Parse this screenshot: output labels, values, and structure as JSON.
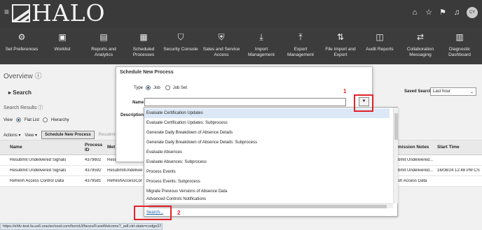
{
  "brand": {
    "logo_text": "HALO"
  },
  "topbar": {
    "avatar_initials": "CY"
  },
  "nav": [
    {
      "label": "Set Preferences",
      "icon": "person-gear-icon"
    },
    {
      "label": "Worklist",
      "icon": "clipboard-icon"
    },
    {
      "label": "Reports and Analytics",
      "icon": "chart-icon"
    },
    {
      "label": "Scheduled Processes",
      "icon": "calendar-grid-icon"
    },
    {
      "label": "Security Console",
      "icon": "shield-icon"
    },
    {
      "label": "Sales and Service Access",
      "icon": "shield-check-icon"
    },
    {
      "label": "Import Management",
      "icon": "download-icon"
    },
    {
      "label": "Export Management",
      "icon": "upload-icon"
    },
    {
      "label": "File Import and Export",
      "icon": "arrows-updown-icon"
    },
    {
      "label": "Audit Reports",
      "icon": "audit-icon"
    },
    {
      "label": "Collaboration Messaging",
      "icon": "arrows-leftright-icon"
    },
    {
      "label": "Diagnostic Dashboard",
      "icon": "dashboard-icon"
    }
  ],
  "page": {
    "title": "Overview",
    "search_heading": "Search",
    "saved_search_label": "Saved Search",
    "saved_search_value": "Last hour",
    "results_heading": "Search Results",
    "view_label": "View",
    "view_flat": "Flat List",
    "view_hierarchy": "Hierarchy",
    "actions_label": "Actions",
    "view_menu_label": "View",
    "schedule_button": "Schedule New Process",
    "resubmit_button": "Resubmit"
  },
  "table": {
    "headers": [
      "Name",
      "Process ID",
      "Met",
      "mission Notes",
      "Start Time"
    ],
    "rows": [
      {
        "name": "Resubmit Undelivered Signals",
        "id": "4379602",
        "met": "Resu",
        "notes": "bmit Undelivered...",
        "start": ""
      },
      {
        "name": "Resubmit Undelivered Signals",
        "id": "4379592",
        "met": "ResubmitUndelivered",
        "notes": "bmit Undelivered...",
        "start": "16/08/24 12:48 PM CS"
      },
      {
        "name": "Refresh Access Control Data",
        "id": "4379581",
        "met": "RefreshAccessContr",
        "notes": "sh Access Data",
        "start": ""
      }
    ]
  },
  "dialog": {
    "title": "Schedule New Process",
    "type_label": "Type",
    "type_job": "Job",
    "type_jobset": "Job Set",
    "name_label": "Name",
    "name_value": "",
    "description_label": "Description"
  },
  "dropdown": {
    "options": [
      "Evaluate Certification Updates",
      "Evaluate Certification Updates: Subprocess",
      "Generate Daily Breakdown of Absence Details",
      "Generate Daily Breakdown of Absence Details: Subprocess",
      "Evaluate Absences",
      "Evaluate Absences: Subprocess",
      "Process Events",
      "Process Events: Subprocess",
      "Migrate Previous Versions of Absence Data",
      "Advanced Controls Notifications"
    ],
    "search_link": "Search..."
  },
  "annotations": {
    "one": "1",
    "two": "2"
  },
  "status_url": "https://ehfv-test.fa.us6.oraclecloud.com/fscmUI/faces/FuseWelcome?_adf.ctrl-state=codge37..."
}
